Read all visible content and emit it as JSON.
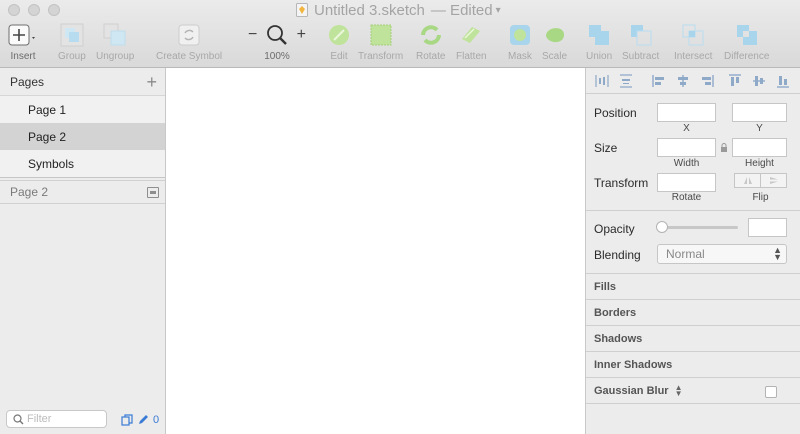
{
  "window": {
    "title": "Untitled 3.sketch",
    "status": "— Edited",
    "traffic_lights": [
      "close",
      "minimize",
      "zoom"
    ]
  },
  "toolbar": {
    "insert": "Insert",
    "group": "Group",
    "ungroup": "Ungroup",
    "create_symbol": "Create Symbol",
    "zoom_out": "−",
    "zoom_in": "+",
    "zoom_level": "100%",
    "edit": "Edit",
    "transform": "Transform",
    "rotate": "Rotate",
    "flatten": "Flatten",
    "mask": "Mask",
    "scale": "Scale",
    "union": "Union",
    "subtract": "Subtract",
    "intersect": "Intersect",
    "difference": "Difference"
  },
  "sidebar": {
    "pages_title": "Pages",
    "add": "+",
    "pages": [
      {
        "label": "Page 1",
        "selected": false
      },
      {
        "label": "Page 2",
        "selected": true
      },
      {
        "label": "Symbols",
        "selected": false
      }
    ],
    "current_page": "Page 2",
    "filter_placeholder": "Filter",
    "layer_count": "0"
  },
  "inspector": {
    "position": "Position",
    "size": "Size",
    "transform": "Transform",
    "x": "X",
    "y": "Y",
    "width": "Width",
    "height": "Height",
    "rotate": "Rotate",
    "flip": "Flip",
    "opacity": "Opacity",
    "blending": "Blending",
    "blending_value": "Normal",
    "sections": [
      "Fills",
      "Borders",
      "Shadows",
      "Inner Shadows",
      "Gaussian Blur"
    ]
  },
  "colors": {
    "accent": "#3a7bd5",
    "icon_green": "#b6dc8f",
    "icon_blue": "#a8d4ec"
  }
}
